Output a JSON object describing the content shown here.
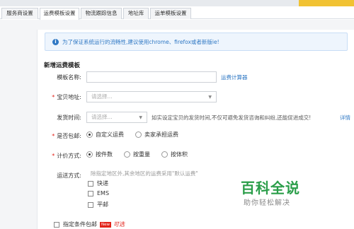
{
  "tabs": [
    {
      "label": "服务商设置",
      "active": false
    },
    {
      "label": "运费模板设置",
      "active": true
    },
    {
      "label": "物流跟踪信息",
      "active": false
    },
    {
      "label": "地址库",
      "active": false
    },
    {
      "label": "运单模板设置",
      "active": false
    }
  ],
  "notice": {
    "icon": "info-icon",
    "text": "为了保证系统运行的流畅性,建议使用chrome、firefox或者新版ie!"
  },
  "section_title": "新增运费模板",
  "form": {
    "template_name": {
      "label": "模板名称:",
      "value": "",
      "link": "运费计算器"
    },
    "location": {
      "label": "宝贝地址:",
      "required": true,
      "placeholder": "请选择..."
    },
    "ship_time": {
      "label": "发货时间:",
      "placeholder": "请选择...",
      "hint": "如实设定宝贝的发货时间,不仅可避免发货咨询和纠纷,还能促进成交!",
      "link": "详情"
    },
    "free_shipping": {
      "label": "是否包邮:",
      "required": true,
      "options": [
        "自定义运费",
        "卖家承担运费"
      ],
      "selected": 0
    },
    "pricing": {
      "label": "计价方式:",
      "required": true,
      "options": [
        "按件数",
        "按重量",
        "按体积"
      ],
      "selected": 0
    },
    "delivery": {
      "label": "运送方式:",
      "hint": "除指定地区外,其余地区的运费采用\"默认运费\"",
      "options": [
        "快递",
        "EMS",
        "平邮"
      ]
    },
    "conditional_free": {
      "label": "指定条件包邮",
      "badge": "New",
      "note": "可选"
    }
  },
  "watermark": {
    "title": "百科全说",
    "subtitle": "助你轻松解决"
  },
  "colors": {
    "link": "#2f78c4",
    "required": "#e2231a",
    "notice_bg": "#eef5fd",
    "watermark": "#2b9e4a"
  }
}
